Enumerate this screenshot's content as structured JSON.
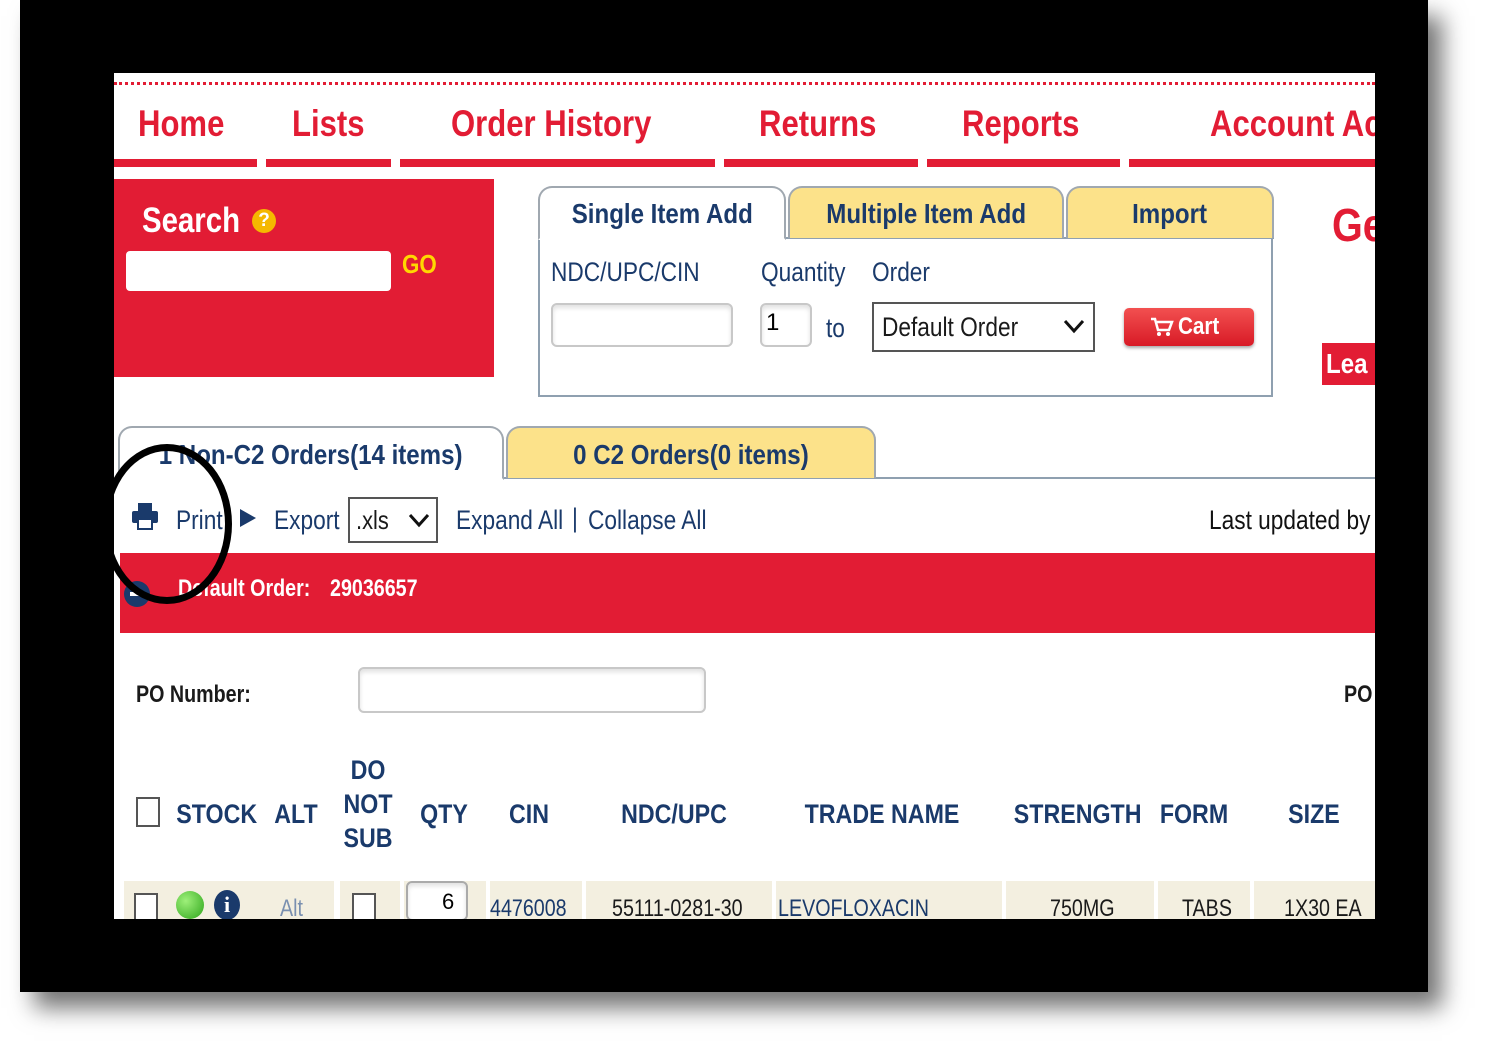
{
  "nav": {
    "items": [
      "Home",
      "Lists",
      "Order History",
      "Returns",
      "Reports",
      "Account Ac"
    ]
  },
  "search": {
    "label": "Search",
    "help_icon": "question-circle-icon",
    "go_label": "GO",
    "input_value": ""
  },
  "add_panel": {
    "tabs": [
      "Single Item Add",
      "Multiple Item Add",
      "Import"
    ],
    "ndc_label": "NDC/UPC/CIN",
    "quantity_label": "Quantity",
    "order_label": "Order",
    "quantity_value": "1",
    "to_label": "to",
    "order_selected": "Default Order",
    "cart_label": "Cart",
    "cart_icon": "cart-icon"
  },
  "right_panel": {
    "heading_partial": "Ge",
    "button_partial": "Lea"
  },
  "order_tabs": [
    "1 Non-C2 Orders(14 items)",
    "0 C2 Orders(0 items)"
  ],
  "toolbar": {
    "print_label": "Print",
    "print_icon": "printer-icon",
    "export_icon": "arrow-right-icon",
    "export_label": "Export",
    "export_format": ".xls",
    "expand_all": "Expand All",
    "separator": "|",
    "collapse_all": "Collapse All",
    "last_updated": "Last updated by"
  },
  "order_bar": {
    "label": "Default Order:",
    "number": "29036657",
    "icon": "collapse-minus-icon"
  },
  "po": {
    "label": "PO Number:",
    "value": "",
    "right_label": "PO"
  },
  "table": {
    "columns": [
      "STOCK",
      "ALT",
      "DO NOT SUB",
      "QTY",
      "CIN",
      "NDC/UPC",
      "TRADE NAME",
      "STRENGTH",
      "FORM",
      "SIZE"
    ],
    "rows": [
      {
        "stock_icon": "green-dot-icon",
        "info_icon": "info-icon",
        "alt": "Alt",
        "qty": "6",
        "cin": "4476008",
        "ndc": "55111-0281-30",
        "trade_name": "LEVOFLOXACIN",
        "strength": "750MG",
        "form": "TABS",
        "size": "1X30 EA"
      }
    ]
  },
  "colors": {
    "brand_red": "#e21c34",
    "tab_yellow": "#fce28a",
    "text_blue": "#1a3a6b",
    "row_bg": "#f3efe0",
    "annotation_circle": "#000000"
  }
}
